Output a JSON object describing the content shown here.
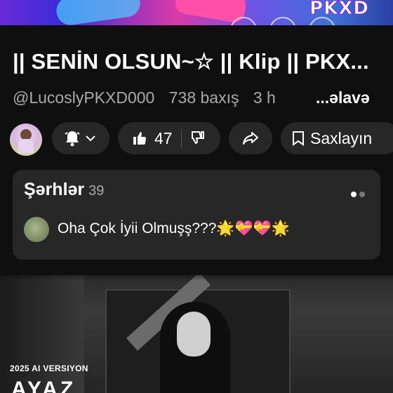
{
  "top_thumbnail": {
    "brand_text": "PKXD"
  },
  "video": {
    "title": "|| SENİN OLSUN~☆ || Klip || PKX...",
    "channel": "@LucoslyPKXD000",
    "views": "738 baxış",
    "age": "3 h",
    "more_label": "...əlavə"
  },
  "actions": {
    "like_count": "47",
    "save_label": "Saxlayın"
  },
  "comments": {
    "header": "Şərhlər",
    "count": "39",
    "top_comment_text": "Oha Çok İyii Olmuşş???🌟💝💝🌟"
  },
  "next_video": {
    "overlay_label": "2025 AI VERSIYON",
    "overlay_title": "AYAZ"
  },
  "icons": {
    "bell": "bell-icon",
    "chevron": "chevron-down-icon",
    "like": "thumbs-up-icon",
    "dislike": "thumbs-down-icon",
    "share": "share-icon",
    "save": "bookmark-icon"
  },
  "colors": {
    "background": "#0f0f0f",
    "pill": "#272727",
    "secondary_text": "#aaaaaa"
  }
}
